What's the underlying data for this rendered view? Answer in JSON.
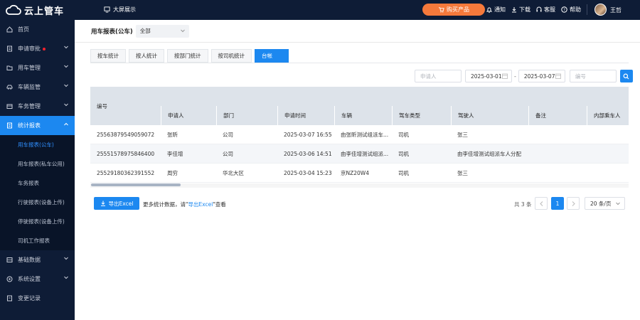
{
  "brand": {
    "name": "云上管车"
  },
  "topbar": {
    "bigscreen": "大屏展示",
    "buy": "购买产品",
    "links": [
      "通知",
      "下载",
      "客服",
      "帮助"
    ],
    "user": "王哲"
  },
  "sidebar": {
    "items": [
      {
        "label": "首页",
        "icon": "home-icon"
      },
      {
        "label": "申请审批",
        "icon": "document-icon"
      },
      {
        "label": "用车管理",
        "icon": "folder-icon"
      },
      {
        "label": "车辆监管",
        "icon": "car-icon"
      },
      {
        "label": "车务管理",
        "icon": "tools-icon"
      },
      {
        "label": "统计报表",
        "icon": "report-icon"
      },
      {
        "label": "基础数据",
        "icon": "database-icon"
      },
      {
        "label": "系统设置",
        "icon": "settings-icon"
      },
      {
        "label": "变更记录",
        "icon": "log-icon"
      }
    ],
    "sub_items": [
      "用车报表(公车)",
      "用车报表(私车公用)",
      "车务报表",
      "行驶报表(设备上传)",
      "停驶报表(设备上传)",
      "司机工作报表"
    ]
  },
  "page": {
    "title": "用车报表(公车)",
    "scope": "全部"
  },
  "tabs": [
    "按车统计",
    "按人统计",
    "按部门统计",
    "按司机统计",
    "台帐"
  ],
  "filters": {
    "applicant_placeholder": "申请人",
    "date_from": "2025-03-01",
    "date_to": "2025-03-07",
    "number_placeholder": "编号"
  },
  "table": {
    "columns": [
      "编号",
      "申请人",
      "部门",
      "申请时间",
      "车辆",
      "驾车类型",
      "驾驶人",
      "备注",
      "内部乘车人"
    ],
    "rows": [
      [
        "25563879549059072",
        "张昕",
        "公司",
        "2025-03-07 16:55",
        "由张昕测试组派车...",
        "司机",
        "张三",
        "",
        ""
      ],
      [
        "25551578975846400",
        "李佳增",
        "公司",
        "2025-03-06 14:51",
        "由李佳增测试组派...",
        "司机",
        "由李佳增测试组派车人分配",
        "",
        ""
      ],
      [
        "25529180362391552",
        "周穷",
        "华北大区",
        "2025-03-04 15:23",
        "京NZ20W4",
        "司机",
        "张三",
        "",
        ""
      ]
    ]
  },
  "footer": {
    "export": "导出Excel",
    "hint_prefix": "更多统计数据，请\"",
    "hint_link": "导出Excel",
    "hint_suffix": "\"查看",
    "total": "共 3 条",
    "current_page": "1",
    "page_size": "20 条/页"
  },
  "colors": {
    "primary": "#1c88f0",
    "nav_bg": "#0e1c36",
    "buy": "#f5793b"
  }
}
